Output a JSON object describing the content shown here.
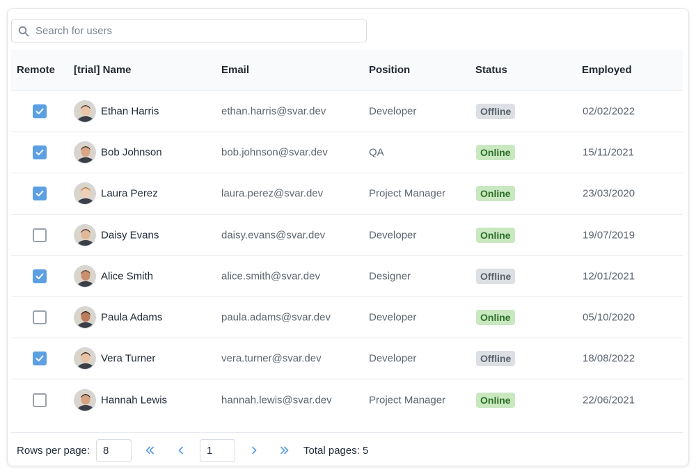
{
  "search": {
    "placeholder": "Search for users"
  },
  "columns": {
    "remote": "Remote",
    "name": "[trial] Name",
    "email": "Email",
    "position": "Position",
    "status": "Status",
    "employed": "Employed"
  },
  "rows": [
    {
      "remote": true,
      "name": "Ethan Harris",
      "email": "ethan.harris@svar.dev",
      "position": "Developer",
      "status": "Offline",
      "employed": "02/02/2022"
    },
    {
      "remote": true,
      "name": "Bob Johnson",
      "email": "bob.johnson@svar.dev",
      "position": "QA",
      "status": "Online",
      "employed": "15/11/2021"
    },
    {
      "remote": true,
      "name": "Laura Perez",
      "email": "laura.perez@svar.dev",
      "position": "Project Manager",
      "status": "Online",
      "employed": "23/03/2020"
    },
    {
      "remote": false,
      "name": "Daisy Evans",
      "email": "daisy.evans@svar.dev",
      "position": "Developer",
      "status": "Online",
      "employed": "19/07/2019"
    },
    {
      "remote": true,
      "name": "Alice Smith",
      "email": "alice.smith@svar.dev",
      "position": "Designer",
      "status": "Offline",
      "employed": "12/01/2021"
    },
    {
      "remote": false,
      "name": "Paula Adams",
      "email": "paula.adams@svar.dev",
      "position": "Developer",
      "status": "Online",
      "employed": "05/10/2020"
    },
    {
      "remote": true,
      "name": "Vera Turner",
      "email": "vera.turner@svar.dev",
      "position": "Developer",
      "status": "Offline",
      "employed": "18/08/2022"
    },
    {
      "remote": false,
      "name": "Hannah Lewis",
      "email": "hannah.lewis@svar.dev",
      "position": "Project Manager",
      "status": "Online",
      "employed": "22/06/2021"
    }
  ],
  "footer": {
    "rows_per_page_label": "Rows per page:",
    "rows_per_page": "8",
    "current_page": "1",
    "total_pages": "Total pages: 5"
  },
  "colors": {
    "accent": "#5d9fe3",
    "online_bg": "#c9e8c0",
    "online_text": "#2f6e2a",
    "offline_bg": "#dcdfe3",
    "offline_text": "#5a626b"
  },
  "icons": {
    "search": "search-icon",
    "check": "check-icon",
    "first": "chevrons-left-icon",
    "prev": "chevron-left-icon",
    "next": "chevron-right-icon",
    "last": "chevrons-right-icon"
  }
}
